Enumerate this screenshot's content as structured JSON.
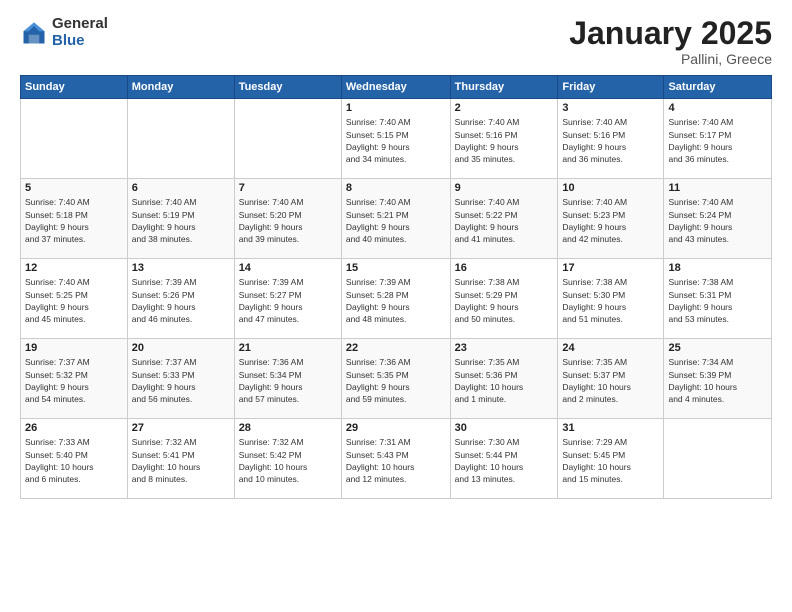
{
  "logo": {
    "general": "General",
    "blue": "Blue"
  },
  "header": {
    "title": "January 2025",
    "subtitle": "Pallini, Greece"
  },
  "days_of_week": [
    "Sunday",
    "Monday",
    "Tuesday",
    "Wednesday",
    "Thursday",
    "Friday",
    "Saturday"
  ],
  "weeks": [
    {
      "days": [
        {
          "number": "",
          "detail": ""
        },
        {
          "number": "",
          "detail": ""
        },
        {
          "number": "",
          "detail": ""
        },
        {
          "number": "1",
          "detail": "Sunrise: 7:40 AM\nSunset: 5:15 PM\nDaylight: 9 hours\nand 34 minutes."
        },
        {
          "number": "2",
          "detail": "Sunrise: 7:40 AM\nSunset: 5:16 PM\nDaylight: 9 hours\nand 35 minutes."
        },
        {
          "number": "3",
          "detail": "Sunrise: 7:40 AM\nSunset: 5:16 PM\nDaylight: 9 hours\nand 36 minutes."
        },
        {
          "number": "4",
          "detail": "Sunrise: 7:40 AM\nSunset: 5:17 PM\nDaylight: 9 hours\nand 36 minutes."
        }
      ]
    },
    {
      "days": [
        {
          "number": "5",
          "detail": "Sunrise: 7:40 AM\nSunset: 5:18 PM\nDaylight: 9 hours\nand 37 minutes."
        },
        {
          "number": "6",
          "detail": "Sunrise: 7:40 AM\nSunset: 5:19 PM\nDaylight: 9 hours\nand 38 minutes."
        },
        {
          "number": "7",
          "detail": "Sunrise: 7:40 AM\nSunset: 5:20 PM\nDaylight: 9 hours\nand 39 minutes."
        },
        {
          "number": "8",
          "detail": "Sunrise: 7:40 AM\nSunset: 5:21 PM\nDaylight: 9 hours\nand 40 minutes."
        },
        {
          "number": "9",
          "detail": "Sunrise: 7:40 AM\nSunset: 5:22 PM\nDaylight: 9 hours\nand 41 minutes."
        },
        {
          "number": "10",
          "detail": "Sunrise: 7:40 AM\nSunset: 5:23 PM\nDaylight: 9 hours\nand 42 minutes."
        },
        {
          "number": "11",
          "detail": "Sunrise: 7:40 AM\nSunset: 5:24 PM\nDaylight: 9 hours\nand 43 minutes."
        }
      ]
    },
    {
      "days": [
        {
          "number": "12",
          "detail": "Sunrise: 7:40 AM\nSunset: 5:25 PM\nDaylight: 9 hours\nand 45 minutes."
        },
        {
          "number": "13",
          "detail": "Sunrise: 7:39 AM\nSunset: 5:26 PM\nDaylight: 9 hours\nand 46 minutes."
        },
        {
          "number": "14",
          "detail": "Sunrise: 7:39 AM\nSunset: 5:27 PM\nDaylight: 9 hours\nand 47 minutes."
        },
        {
          "number": "15",
          "detail": "Sunrise: 7:39 AM\nSunset: 5:28 PM\nDaylight: 9 hours\nand 48 minutes."
        },
        {
          "number": "16",
          "detail": "Sunrise: 7:38 AM\nSunset: 5:29 PM\nDaylight: 9 hours\nand 50 minutes."
        },
        {
          "number": "17",
          "detail": "Sunrise: 7:38 AM\nSunset: 5:30 PM\nDaylight: 9 hours\nand 51 minutes."
        },
        {
          "number": "18",
          "detail": "Sunrise: 7:38 AM\nSunset: 5:31 PM\nDaylight: 9 hours\nand 53 minutes."
        }
      ]
    },
    {
      "days": [
        {
          "number": "19",
          "detail": "Sunrise: 7:37 AM\nSunset: 5:32 PM\nDaylight: 9 hours\nand 54 minutes."
        },
        {
          "number": "20",
          "detail": "Sunrise: 7:37 AM\nSunset: 5:33 PM\nDaylight: 9 hours\nand 56 minutes."
        },
        {
          "number": "21",
          "detail": "Sunrise: 7:36 AM\nSunset: 5:34 PM\nDaylight: 9 hours\nand 57 minutes."
        },
        {
          "number": "22",
          "detail": "Sunrise: 7:36 AM\nSunset: 5:35 PM\nDaylight: 9 hours\nand 59 minutes."
        },
        {
          "number": "23",
          "detail": "Sunrise: 7:35 AM\nSunset: 5:36 PM\nDaylight: 10 hours\nand 1 minute."
        },
        {
          "number": "24",
          "detail": "Sunrise: 7:35 AM\nSunset: 5:37 PM\nDaylight: 10 hours\nand 2 minutes."
        },
        {
          "number": "25",
          "detail": "Sunrise: 7:34 AM\nSunset: 5:39 PM\nDaylight: 10 hours\nand 4 minutes."
        }
      ]
    },
    {
      "days": [
        {
          "number": "26",
          "detail": "Sunrise: 7:33 AM\nSunset: 5:40 PM\nDaylight: 10 hours\nand 6 minutes."
        },
        {
          "number": "27",
          "detail": "Sunrise: 7:32 AM\nSunset: 5:41 PM\nDaylight: 10 hours\nand 8 minutes."
        },
        {
          "number": "28",
          "detail": "Sunrise: 7:32 AM\nSunset: 5:42 PM\nDaylight: 10 hours\nand 10 minutes."
        },
        {
          "number": "29",
          "detail": "Sunrise: 7:31 AM\nSunset: 5:43 PM\nDaylight: 10 hours\nand 12 minutes."
        },
        {
          "number": "30",
          "detail": "Sunrise: 7:30 AM\nSunset: 5:44 PM\nDaylight: 10 hours\nand 13 minutes."
        },
        {
          "number": "31",
          "detail": "Sunrise: 7:29 AM\nSunset: 5:45 PM\nDaylight: 10 hours\nand 15 minutes."
        },
        {
          "number": "",
          "detail": ""
        }
      ]
    }
  ]
}
